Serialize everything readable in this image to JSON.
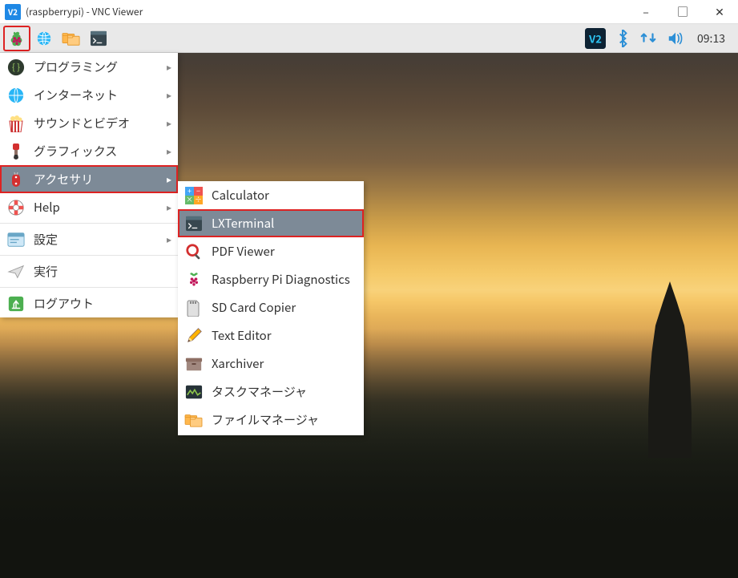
{
  "window": {
    "title": "(raspberrypi) - VNC Viewer",
    "app_badge": "V2"
  },
  "panel": {
    "clock": "09:13"
  },
  "menu": {
    "items": [
      {
        "label": "プログラミング",
        "has_sub": true
      },
      {
        "label": "インターネット",
        "has_sub": true
      },
      {
        "label": "サウンドとビデオ",
        "has_sub": true
      },
      {
        "label": "グラフィックス",
        "has_sub": true
      },
      {
        "label": "アクセサリ",
        "has_sub": true,
        "highlighted": true
      },
      {
        "label": "Help",
        "has_sub": true
      },
      {
        "label": "設定",
        "has_sub": true
      },
      {
        "label": "実行"
      },
      {
        "label": "ログアウト"
      }
    ]
  },
  "submenu": {
    "items": [
      {
        "label": "Calculator"
      },
      {
        "label": "LXTerminal",
        "highlighted": true
      },
      {
        "label": "PDF Viewer"
      },
      {
        "label": "Raspberry Pi Diagnostics"
      },
      {
        "label": "SD Card Copier"
      },
      {
        "label": "Text Editor"
      },
      {
        "label": "Xarchiver"
      },
      {
        "label": "タスクマネージャ"
      },
      {
        "label": "ファイルマネージャ"
      }
    ]
  }
}
